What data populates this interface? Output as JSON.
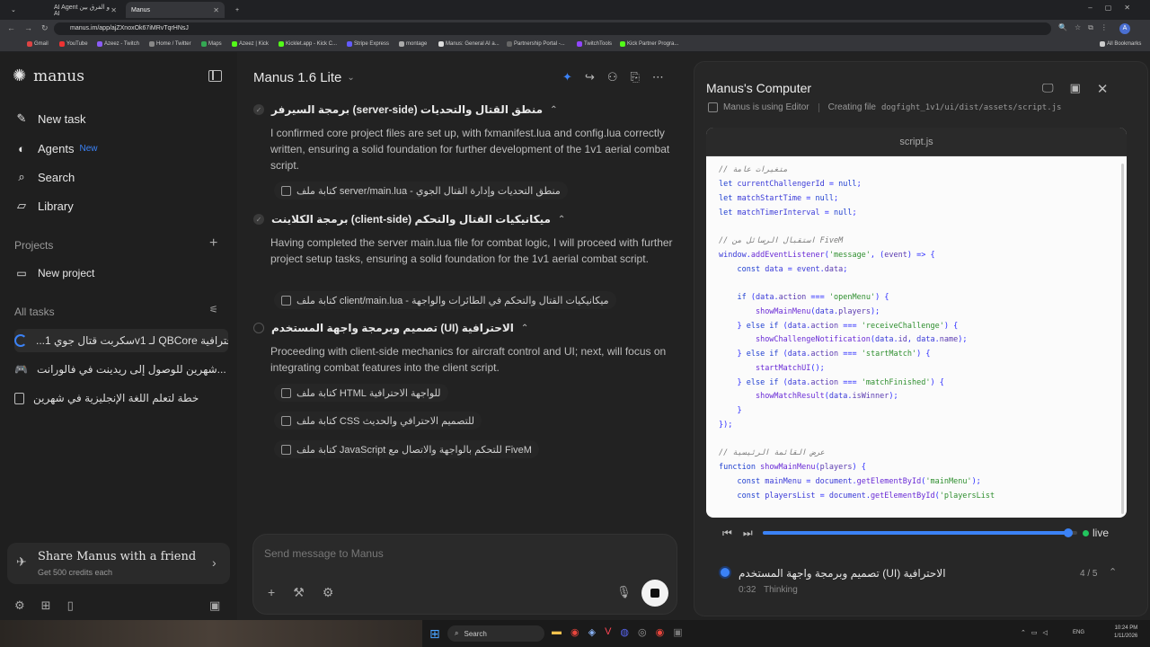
{
  "browser": {
    "tabs": [
      {
        "label": "AI Agent و الفرق بين AI"
      },
      {
        "label": "Manus"
      }
    ],
    "url": "manus.im/app/ajZXnoxOk67iMRvTqrHNsJ",
    "bookmarks": [
      "Gmail",
      "YouTube",
      "Azeez - Twitch",
      "Home / Twitter",
      "Maps",
      "Azeez | Kick",
      "Kicklet.app - Kick C...",
      "Stripe Express",
      "montage",
      "Manus: General AI a...",
      "Partnership Portal -...",
      "TwitchTools",
      "Kick Partner Progra..."
    ],
    "all_bookmarks": "All Bookmarks"
  },
  "sidebar": {
    "logo": "manus",
    "nav": [
      {
        "label": "New task",
        "icon": "edit-icon"
      },
      {
        "label": "Agents",
        "badge": "New",
        "icon": "agents-icon"
      },
      {
        "label": "Search",
        "icon": "search-icon"
      },
      {
        "label": "Library",
        "icon": "library-icon"
      }
    ],
    "projects_label": "Projects",
    "new_project": "New project",
    "all_tasks_label": "All tasks",
    "tasks": [
      {
        "label": "احترافية QBCore لـ v1سكربت قتال جوي 1..."
      },
      {
        "label": "...شهرين للوصول إلى ريدينت في فالورانت"
      },
      {
        "label": "خطة لتعلم اللغة الإنجليزية في شهرين"
      }
    ],
    "share_title": "Share Manus with a friend",
    "share_sub": "Get 500 credits each"
  },
  "main": {
    "title": "Manus 1.6 Lite",
    "steps": [
      {
        "title": "منطق القتال والتحديات (server-side) برمجة السيرفر",
        "text": "I confirmed core project files are set up, with fxmanifest.lua and config.lua correctly written, ensuring a solid foundation for further development of the 1v1 aerial combat script.",
        "pills": [
          "منطق التحديات وإدارة القتال الجوي - server/main.lua كتابة ملف"
        ]
      },
      {
        "title": "ميكانيكيات القتال والتحكم (client-side) برمجة الكلاينت",
        "text": "Having completed the server main.lua file for combat logic, I will proceed with further project setup tasks, ensuring a solid foundation for the 1v1 aerial combat script.",
        "pills": [
          "ميكانيكيات القتال والتحكم في الطائرات والواجهة - client/main.lua كتابة ملف"
        ]
      },
      {
        "title": "الاحترافية (UI) تصميم وبرمجة واجهة المستخدم",
        "text": "Proceeding with client-side mechanics for aircraft control and UI; next, will focus on integrating combat features into the client script.",
        "pills": [
          "للواجهة الاحترافية HTML كتابة ملف",
          "للتصميم الاحترافي والحديث CSS كتابة ملف",
          "FiveM للتحكم بالواجهة والاتصال مع JavaScript كتابة ملف"
        ]
      }
    ],
    "input_placeholder": "Send message to Manus"
  },
  "computer": {
    "title": "Manus's Computer",
    "status_tool": "Manus is using Editor",
    "status_action": "Creating file",
    "status_path": "dogfight_1v1/ui/dist/assets/script.js",
    "file_name": "script.js",
    "live_label": "live",
    "progress": 0.97,
    "task_title": "الاحترافية (UI) تصميم وبرمجة واجهة المستخدم",
    "task_time": "0:32",
    "task_state": "Thinking",
    "task_count": "4 / 5"
  },
  "colors": {
    "accent": "#3b82f6",
    "live": "#22c55e"
  },
  "taskbar": {
    "search": "Search",
    "lang": "ENG",
    "time": "10:24 PM",
    "date": "1/11/2026"
  }
}
